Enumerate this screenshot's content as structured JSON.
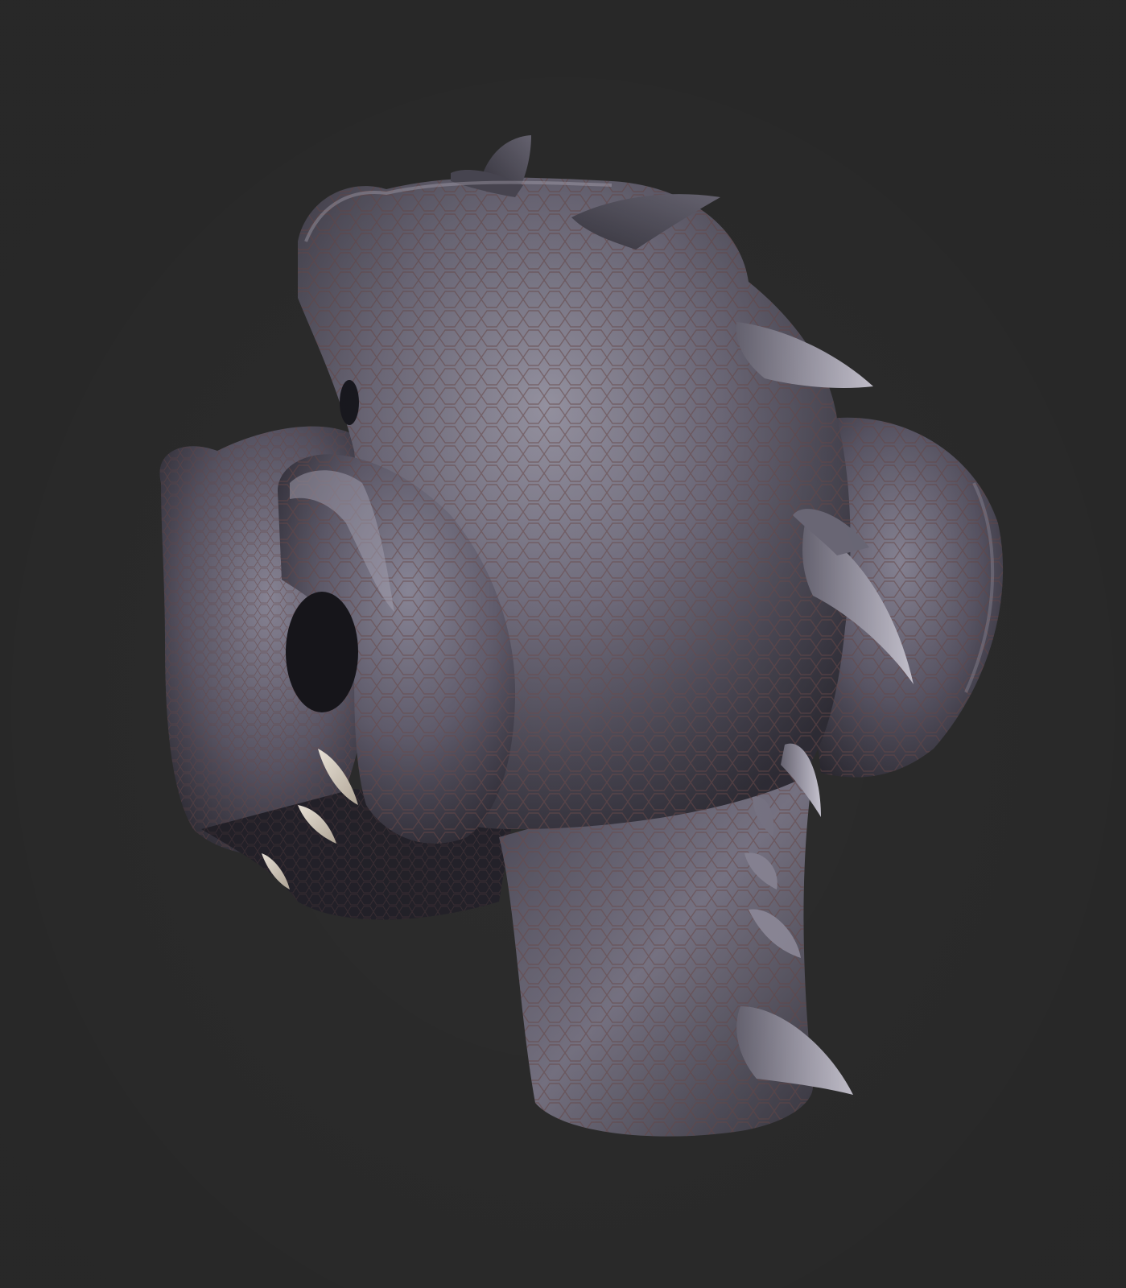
{
  "scene": {
    "background_color": "#2d2d2d",
    "subject": "creature-head-sculpt",
    "palette": {
      "skin_light": "#8a8796",
      "skin_mid": "#5e5a68",
      "skin_dark": "#2a2830",
      "skin_shadow": "#1c1b20",
      "scale_line": "#6b4a4a",
      "horn_light": "#b9b6c2",
      "horn_dark": "#55525e",
      "tooth": "#e6dccd",
      "rim_light": "#c8c4d2"
    }
  }
}
